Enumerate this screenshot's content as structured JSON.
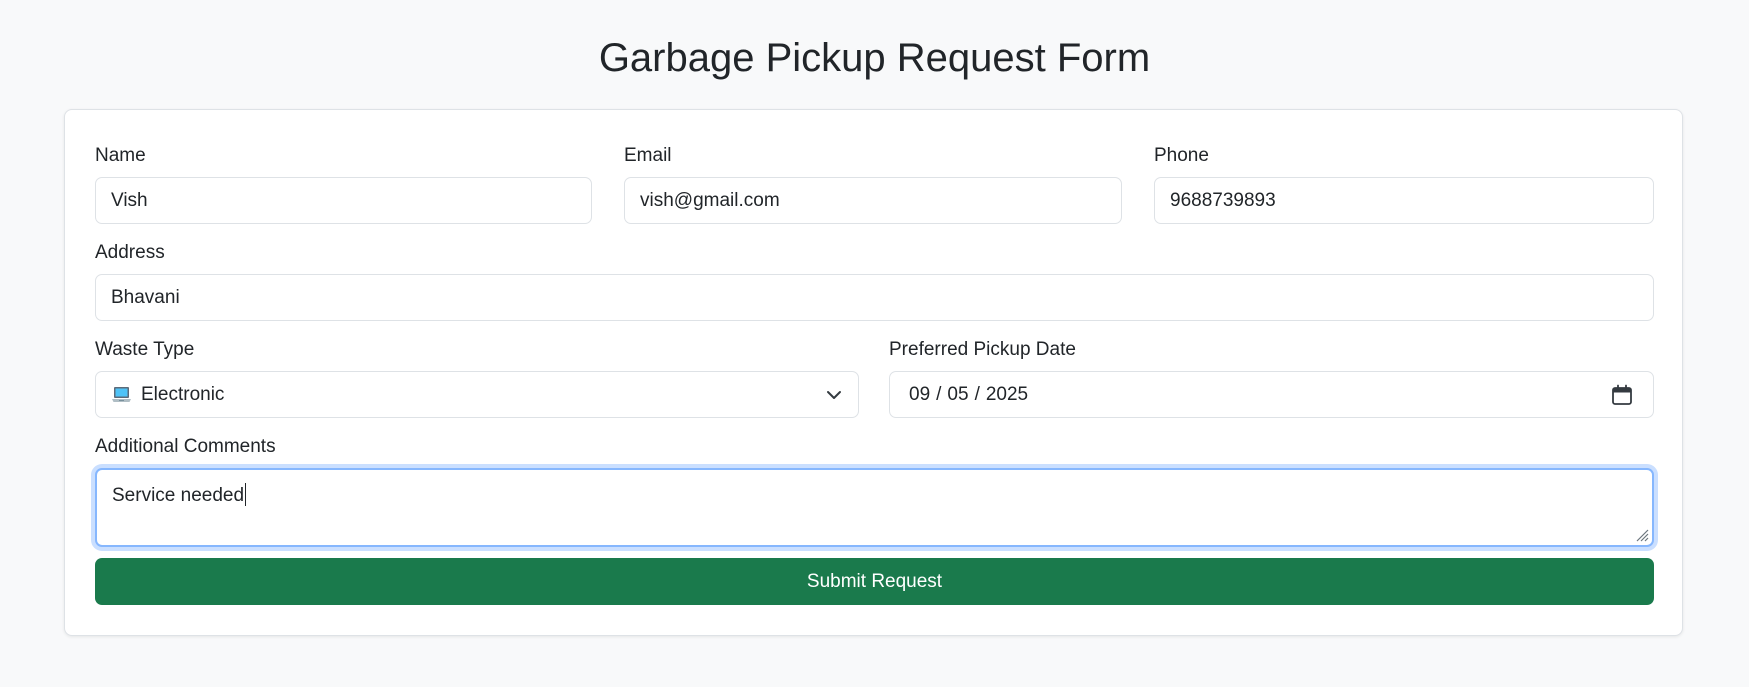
{
  "page": {
    "title": "Garbage Pickup Request Form"
  },
  "form": {
    "name": {
      "label": "Name",
      "value": "Vish"
    },
    "email": {
      "label": "Email",
      "value": "vish@gmail.com"
    },
    "phone": {
      "label": "Phone",
      "value": "9688739893"
    },
    "address": {
      "label": "Address",
      "value": "Bhavani"
    },
    "waste_type": {
      "label": "Waste Type",
      "selected": "Electronic",
      "icon": "laptop-icon"
    },
    "pickup_date": {
      "label": "Preferred Pickup Date",
      "month": "09",
      "day": "05",
      "year": "2025",
      "separator": "/"
    },
    "comments": {
      "label": "Additional Comments",
      "value": "Service needed"
    },
    "submit_label": "Submit Request"
  },
  "colors": {
    "background": "#f8f9fa",
    "submit_button": "#1a7a4c",
    "focus_ring": "#86b7fe",
    "border": "#dee2e6"
  }
}
